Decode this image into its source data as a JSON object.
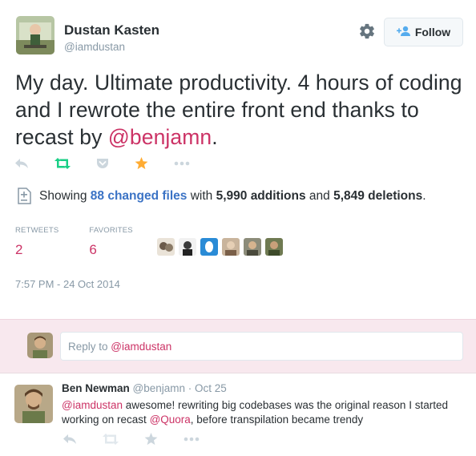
{
  "author": {
    "name": "Dustan Kasten",
    "handle": "@iamdustan",
    "follow_label": "Follow"
  },
  "tweet": {
    "text_before": "My day. Ultimate productivity. 4 hours of coding and I rewrote the entire front end thanks to recast by ",
    "mention": "@benjamn",
    "text_after": "."
  },
  "card": {
    "showing": "Showing",
    "changed_files": "88 changed files",
    "with": "with",
    "additions": "5,990 additions",
    "and": "and",
    "deletions": "5,849 deletions",
    "end": "."
  },
  "stats": {
    "retweets_label": "RETWEETS",
    "retweets_value": "2",
    "favorites_label": "FAVORITES",
    "favorites_value": "6"
  },
  "timestamp": "7:57 PM - 24 Oct 2014",
  "reply_box": {
    "prefix": "Reply to ",
    "mention": "@iamdustan"
  },
  "reply_tweet": {
    "name": "Ben Newman",
    "handle": "@benjamn",
    "separator": " · ",
    "date": "Oct 25",
    "mention1": "@iamdustan",
    "text1": " awesome! rewriting big codebases was the original reason I started working on recast ",
    "mention2": "@Quora",
    "text2": ", before transpilation became trendy"
  },
  "colors": {
    "mention": "#cc3366",
    "link_blue": "#3b73c5",
    "muted": "#8899a6",
    "retweet_green": "#19cf86",
    "favorite_orange": "#ffac33",
    "reply_bg": "#f8e8ee"
  },
  "icons": [
    "settings-gear-icon",
    "follow-user-icon",
    "reply-icon",
    "retweet-icon",
    "pocket-icon",
    "favorite-star-icon",
    "more-icon",
    "file-diff-icon"
  ]
}
